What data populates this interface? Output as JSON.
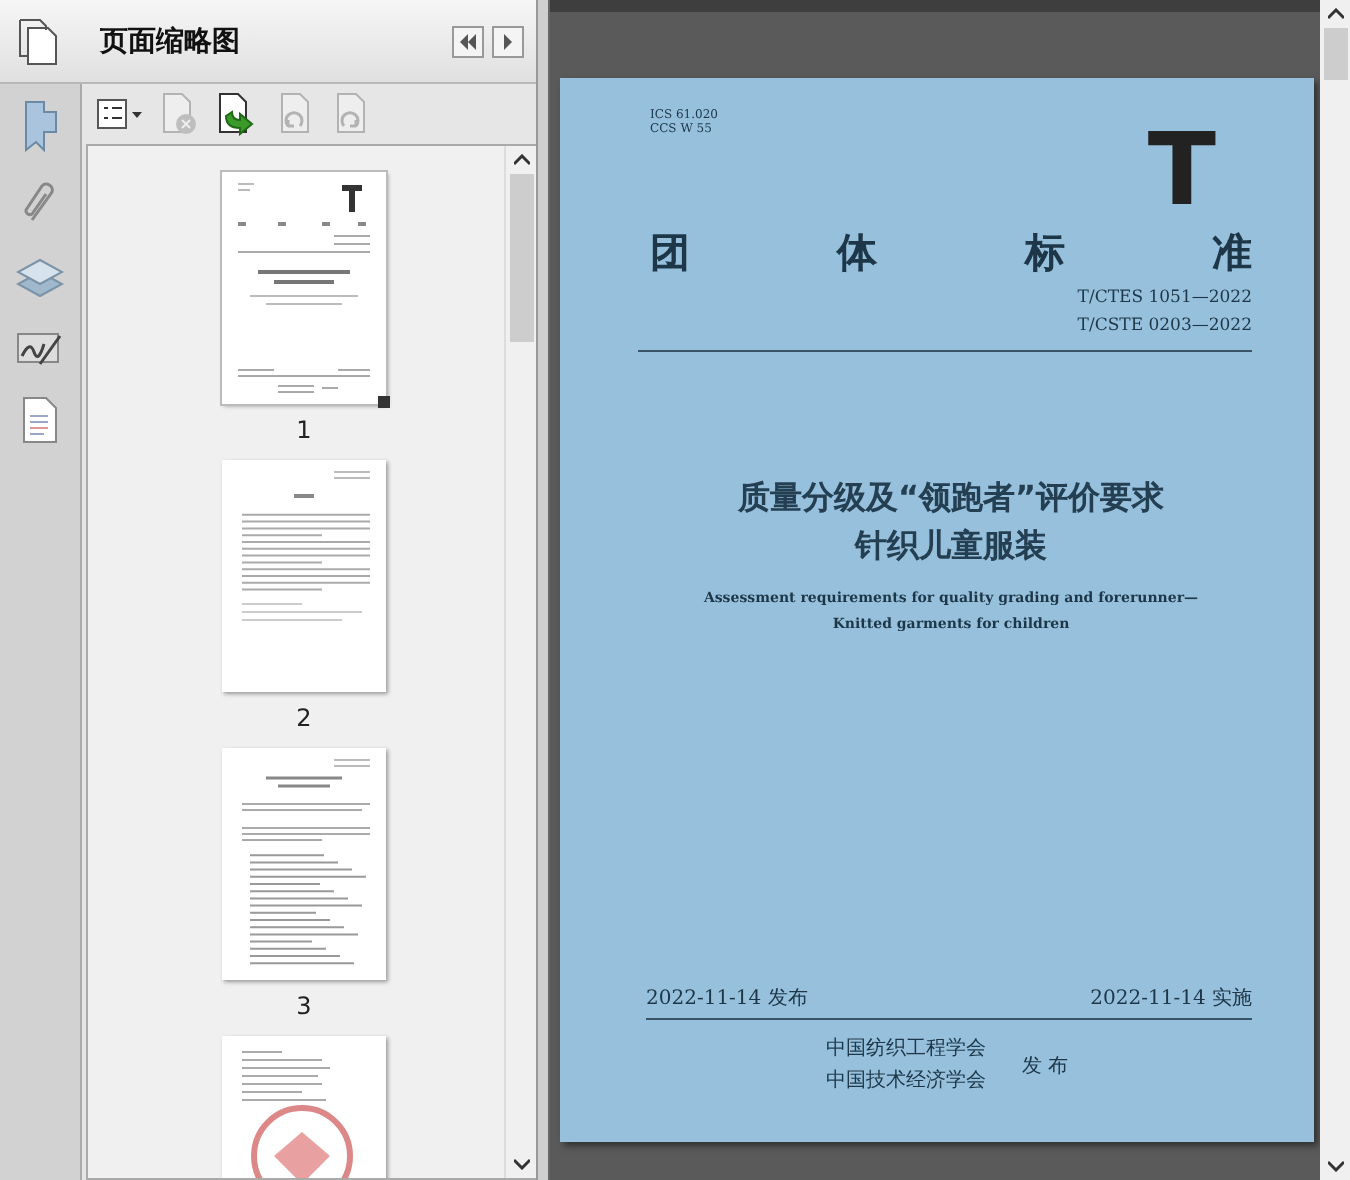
{
  "panel": {
    "title": "页面缩略图"
  },
  "toolbar": [
    {
      "kind": "options",
      "disabled": false
    },
    {
      "kind": "delete",
      "disabled": true
    },
    {
      "kind": "insert",
      "disabled": false
    },
    {
      "kind": "undo",
      "disabled": true
    },
    {
      "kind": "redo",
      "disabled": true
    }
  ],
  "thumbnails": [
    {
      "kind": "cover",
      "label": "1",
      "selected": true
    },
    {
      "kind": "text",
      "label": "2",
      "selected": false
    },
    {
      "kind": "list",
      "label": "3",
      "selected": false
    },
    {
      "kind": "stamp",
      "selected": false
    }
  ],
  "document": {
    "codes": [
      "ICS 61.020",
      "CCS W 55"
    ],
    "logo": "T",
    "category": [
      "团",
      "体",
      "标",
      "准"
    ],
    "standard_numbers": [
      "T/CTES 1051—2022",
      "T/CSTE 0203—2022"
    ],
    "title_lines": [
      "质量分级及“领跑者”评价要求",
      "针织儿童服装"
    ],
    "english_title_lines": [
      "Assessment requirements for quality grading and forerunner—",
      "Knitted garments for children"
    ],
    "publish_date": "2022-11-14 发布",
    "implement_date": "2022-11-14 实施",
    "publishers": [
      "中国纺织工程学会",
      "中国技术经济学会"
    ],
    "publish_label": "发 布"
  }
}
